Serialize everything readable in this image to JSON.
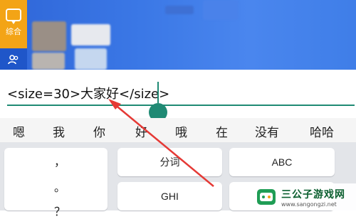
{
  "sidebar": {
    "items": [
      {
        "label": "综合",
        "icon": "chat-icon"
      },
      {
        "label": "",
        "icon": "people-icon"
      }
    ]
  },
  "input": {
    "value": "<size=30>大家好</size>"
  },
  "candidates": [
    "嗯",
    "我",
    "你",
    "好",
    "哦",
    "在",
    "没有",
    "哈哈"
  ],
  "keyboard": {
    "punctuation": [
      "，",
      "。",
      "？"
    ],
    "keys": [
      "分词",
      "ABC",
      "GHI",
      ""
    ]
  },
  "watermark": {
    "title": "三公子游戏网",
    "url": "www.sangongzi.net"
  },
  "colors": {
    "accent": "#1f8a74",
    "sidebar_active": "#f3a416",
    "annotation": "#e53935"
  }
}
